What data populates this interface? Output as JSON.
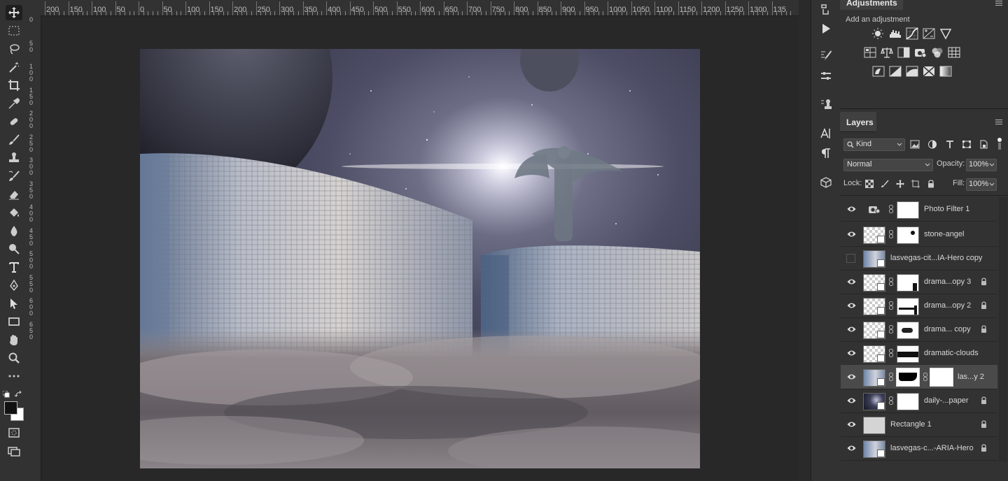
{
  "ruler": {
    "top_labels": [
      "200",
      "150",
      "100",
      "50",
      "0",
      "50",
      "100",
      "150",
      "200",
      "250",
      "300",
      "350",
      "400",
      "450",
      "500",
      "550",
      "600",
      "650",
      "700",
      "750",
      "800",
      "850",
      "900",
      "950",
      "1000",
      "1050",
      "1100",
      "1150",
      "1200",
      "1250",
      "1300",
      "135"
    ],
    "left_labels": [
      "0",
      "5\n0",
      "1\n0\n0",
      "1\n5\n0",
      "2\n0\n0",
      "2\n5\n0",
      "3\n0\n0",
      "3\n5\n0",
      "4\n0\n0",
      "4\n5\n0",
      "5\n0\n0",
      "5\n5\n0",
      "6\n0\n0",
      "6\n5\n0"
    ]
  },
  "tools": [
    "move-icon",
    "rectangular-marquee-icon",
    "lasso-icon",
    "magic-wand-icon",
    "crop-icon",
    "eyedropper-icon",
    "healing-brush-icon",
    "brush-icon",
    "clone-stamp-icon",
    "history-brush-icon",
    "eraser-icon",
    "paint-bucket-icon",
    "blur-icon",
    "dodge-icon",
    "type-icon",
    "pen-icon",
    "path-selection-icon",
    "rectangle-icon",
    "hand-icon",
    "zoom-icon",
    "more-tools-icon"
  ],
  "colors": {
    "foreground": "#111111",
    "background": "#ffffff",
    "selection": "#4a4a4a",
    "panel": "#323232"
  },
  "adjustments": {
    "tab": "Adjustments",
    "subtitle": "Add an adjustment",
    "row1": [
      "brightness-contrast-icon",
      "levels-icon",
      "curves-icon",
      "exposure-icon",
      "vibrance-icon"
    ],
    "row2": [
      "hue-saturation-icon",
      "color-balance-icon",
      "black-white-icon",
      "photo-filter-icon",
      "channel-mixer-icon",
      "color-lookup-icon"
    ],
    "row3": [
      "invert-icon",
      "posterize-icon",
      "threshold-icon",
      "selective-color-icon",
      "gradient-map-icon"
    ]
  },
  "layers": {
    "tab": "Layers",
    "filter_kind": "Kind",
    "blend_mode": "Normal",
    "opacity_label": "Opacity:",
    "opacity_value": "100%",
    "lock_label": "Lock:",
    "fill_label": "Fill:",
    "fill_value": "100%",
    "items": [
      {
        "name": "Photo Filter 1",
        "visible": true,
        "locked": false,
        "type": "adjustment"
      },
      {
        "name": "stone-angel",
        "visible": true,
        "locked": false,
        "type": "smart-masked"
      },
      {
        "name": "lasvegas-cit...IA-Hero copy",
        "visible": false,
        "locked": false,
        "type": "image"
      },
      {
        "name": "drama...opy 3",
        "visible": true,
        "locked": true,
        "type": "smart-masked"
      },
      {
        "name": "drama...opy 2",
        "visible": true,
        "locked": true,
        "type": "smart-masked"
      },
      {
        "name": "drama... copy",
        "visible": true,
        "locked": true,
        "type": "smart-masked"
      },
      {
        "name": "dramatic-clouds",
        "visible": true,
        "locked": false,
        "type": "smart-masked"
      },
      {
        "name": "las...y 2",
        "visible": true,
        "locked": false,
        "type": "double-masked",
        "selected": true
      },
      {
        "name": "daily-...paper",
        "visible": true,
        "locked": true,
        "type": "smart-masked"
      },
      {
        "name": "Rectangle 1",
        "visible": true,
        "locked": true,
        "type": "shape"
      },
      {
        "name": "lasvegas-c...-ARIA-Hero",
        "visible": true,
        "locked": true,
        "type": "image"
      }
    ]
  }
}
